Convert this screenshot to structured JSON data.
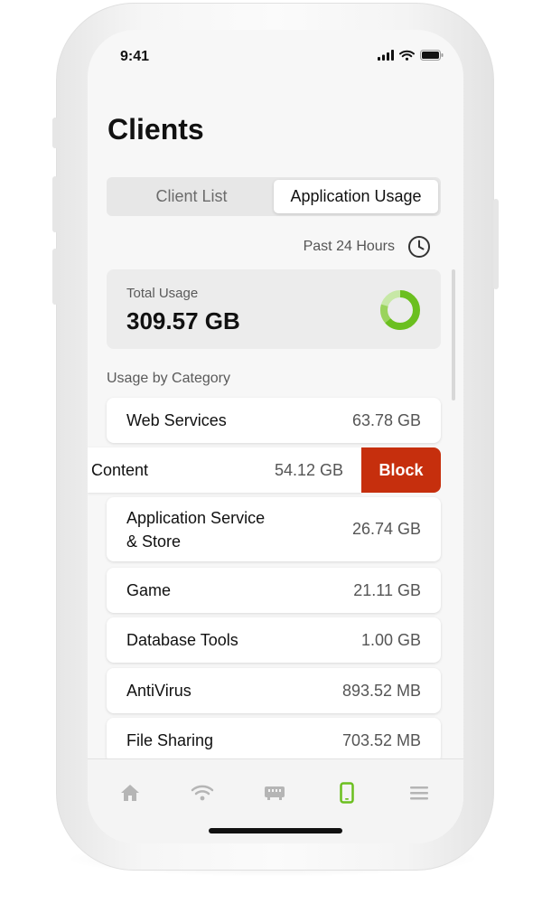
{
  "status_bar": {
    "time": "9:41"
  },
  "page": {
    "title": "Clients"
  },
  "tabs": [
    {
      "label": "Client List",
      "active": false
    },
    {
      "label": "Application Usage",
      "active": true
    }
  ],
  "time_filter": {
    "label": "Past 24 Hours"
  },
  "total_usage": {
    "label": "Total Usage",
    "value": "309.57 GB"
  },
  "category_heading": "Usage by Category",
  "categories": [
    {
      "name": "Web Services",
      "size": "63.78 GB"
    },
    {
      "name": "Content",
      "size": "54.12 GB",
      "swiped": true,
      "action_label": "Block"
    },
    {
      "name": "Application Service",
      "name_line2": "& Store",
      "size": "26.74 GB"
    },
    {
      "name": "Game",
      "size": "21.11 GB"
    },
    {
      "name": "Database Tools",
      "size": "1.00 GB"
    },
    {
      "name": "AntiVirus",
      "size": "893.52 MB"
    },
    {
      "name": "File Sharing",
      "size": "703.52 MB"
    }
  ],
  "bottom_nav": [
    {
      "icon": "home-icon",
      "active": false
    },
    {
      "icon": "wifi-icon",
      "active": false
    },
    {
      "icon": "router-icon",
      "active": false
    },
    {
      "icon": "phone-icon",
      "active": true
    },
    {
      "icon": "menu-icon",
      "active": false
    }
  ],
  "colors": {
    "accent_green": "#6bbf1f",
    "block_red": "#c62f0d",
    "inactive_icon": "#b5b5b5"
  }
}
